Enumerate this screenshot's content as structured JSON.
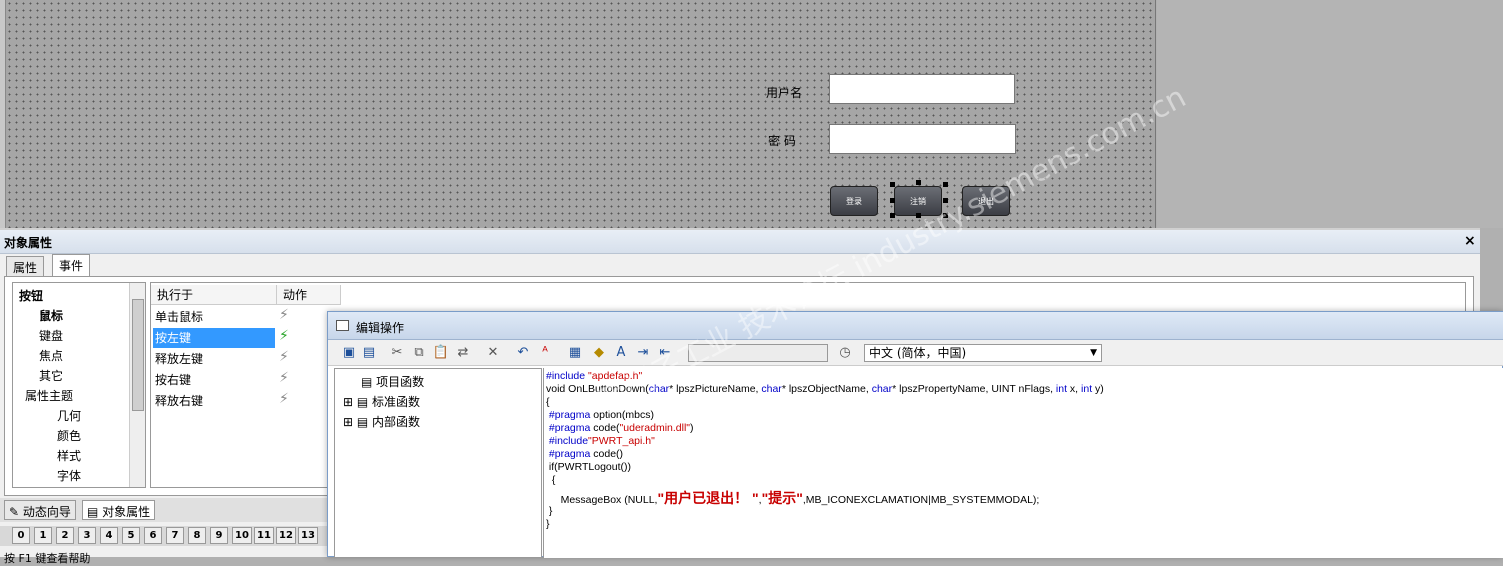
{
  "canvas": {
    "username_label": "用户名",
    "password_label": "密  码",
    "buttons": [
      "登录",
      "注销",
      "退出"
    ]
  },
  "props": {
    "title": "对象属性",
    "close": "×",
    "tabs": [
      "属性",
      "事件"
    ],
    "tree": [
      "按钮",
      "鼠标",
      "键盘",
      "焦点",
      "其它",
      "属性主题",
      "几何",
      "颜色",
      "样式",
      "字体"
    ],
    "columns": [
      "执行于",
      "动作"
    ],
    "events": [
      "单击鼠标",
      "按左键",
      "释放左键",
      "按右键",
      "释放右键"
    ],
    "bottom_tabs": [
      "动态向导",
      "对象属性"
    ],
    "numbers": [
      "0",
      "1",
      "2",
      "3",
      "4",
      "5",
      "6",
      "7",
      "8",
      "9",
      "10",
      "11",
      "12",
      "13"
    ],
    "status": "按 F1 键查看帮助"
  },
  "editor": {
    "title": "编辑操作",
    "language": "中文 (简体，中国)",
    "functions": [
      "项目函数",
      "标准函数",
      "内部函数"
    ],
    "code": {
      "l1a": "#include ",
      "l1b": "\"apdefap.h\"",
      "l2a": "void OnLButtonDown(",
      "l2b": "char",
      "l2c": "* lpszPictureName, ",
      "l2d": "char",
      "l2e": "* lpszObjectName, ",
      "l2f": "char",
      "l2g": "* lpszPropertyName, UINT nFlags, ",
      "l2h": "int",
      "l2i": " x, ",
      "l2j": "int",
      "l2k": " y)",
      "l3": "{",
      "l4a": " #pragma",
      "l4b": " option(mbcs)",
      "l5a": " #pragma",
      "l5b": " code(",
      "l5c": "\"uderadmin.dll\"",
      "l5d": ")",
      "l6a": " #include",
      "l6b": "\"PWRT_api.h\"",
      "l7a": " #pragma",
      "l7b": " code()",
      "l8": " if(PWRTLogout())",
      "l9": "  {",
      "l10a": "     MessageBox (NULL,",
      "l10b": "\"用户已退出！ \"",
      "l10c": ",",
      "l10d": "\"提示\"",
      "l10e": ",MB_ICONEXCLAMATION|MB_SYSTEMMODAL);",
      "l11": " }",
      "l12": "}"
    }
  },
  "watermark": "西门子工业 技术论坛 industry.siemens.com.cn"
}
